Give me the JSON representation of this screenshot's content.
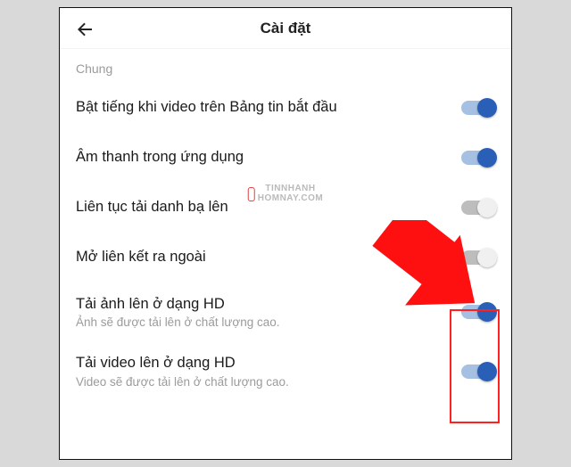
{
  "header": {
    "title": "Cài đặt"
  },
  "section": {
    "label": "Chung"
  },
  "rows": [
    {
      "label": "Bật tiếng khi video trên Bảng tin bắt đầu",
      "sub": "",
      "on": true
    },
    {
      "label": "Âm thanh trong ứng dụng",
      "sub": "",
      "on": true
    },
    {
      "label": "Liên tục tải danh bạ lên",
      "sub": "",
      "on": false
    },
    {
      "label": "Mở liên kết ra ngoài",
      "sub": "",
      "on": false
    },
    {
      "label": "Tải ảnh lên ở dạng HD",
      "sub": "Ảnh sẽ được tải lên ở chất lượng cao.",
      "on": true
    },
    {
      "label": "Tải video lên ở dạng HD",
      "sub": "Video sẽ được tải lên ở chất lượng cao.",
      "on": true
    }
  ],
  "watermark": {
    "line1": "TINNHANH",
    "line2": "HOMNAY.COM"
  }
}
